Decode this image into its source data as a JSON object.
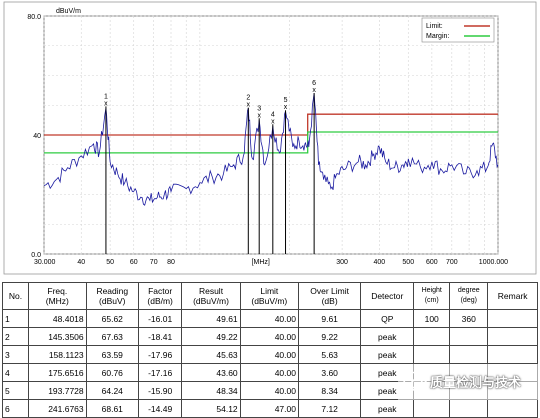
{
  "chart_data": {
    "type": "line",
    "unit_label": "dBuV/m",
    "x_unit_label": "[MHz]",
    "xscale": "log",
    "xlim": [
      30,
      1000
    ],
    "ylim": [
      0,
      80
    ],
    "x_tick_labels": [
      "30.000",
      "40",
      "50",
      "60",
      "70",
      "80",
      "300",
      "400",
      "500",
      "600",
      "700",
      "1000.000"
    ],
    "x_tick_values": [
      30,
      40,
      50,
      60,
      70,
      80,
      300,
      400,
      500,
      600,
      700,
      1000
    ],
    "y_tick_labels": [
      "80.0",
      "40",
      "0.0"
    ],
    "y_tick_values": [
      80,
      40,
      0
    ],
    "grid": true,
    "legend_position": "top-right",
    "legend": [
      {
        "name": "Limit:",
        "color": "#c0392b"
      },
      {
        "name": "Margin:",
        "color": "#2ecc40"
      }
    ],
    "limit_line": {
      "color": "#c0392b",
      "points": [
        [
          30,
          40
        ],
        [
          230,
          40
        ],
        [
          230,
          47
        ],
        [
          1000,
          47
        ]
      ]
    },
    "margin_line": {
      "color": "#2ecc40",
      "points": [
        [
          30,
          34
        ],
        [
          230,
          34
        ],
        [
          230,
          41
        ],
        [
          1000,
          41
        ]
      ]
    },
    "trace": {
      "color": "#1a1aa0",
      "x": [
        30,
        33,
        36,
        40,
        44,
        46,
        48.4,
        50,
        53,
        56,
        60,
        64,
        68,
        72,
        76,
        80,
        90,
        100,
        110,
        120,
        130,
        140,
        145.35,
        150,
        158.11,
        165,
        175.65,
        185,
        193.77,
        205,
        215,
        225,
        232,
        241.68,
        250,
        260,
        275,
        290,
        310,
        340,
        360,
        380,
        400,
        420,
        450,
        480,
        500,
        550,
        600,
        650,
        700,
        780,
        850,
        920,
        960,
        1000
      ],
      "y": [
        23,
        25,
        29,
        33,
        37,
        34,
        49,
        31,
        27,
        24,
        21,
        19,
        18,
        19,
        20,
        21,
        22,
        24,
        26,
        27,
        30,
        33,
        49,
        32,
        45,
        30,
        43,
        34,
        48,
        36,
        38,
        37,
        36,
        54,
        30,
        25,
        22,
        27,
        29,
        31,
        30,
        33,
        36,
        31,
        29,
        30,
        32,
        29,
        31,
        28,
        30,
        27,
        28,
        29,
        37,
        30
      ]
    },
    "markers": [
      {
        "label": "1",
        "freq": 48.4018,
        "level": 49.61
      },
      {
        "label": "2",
        "freq": 145.3506,
        "level": 49.22
      },
      {
        "label": "3",
        "freq": 158.1123,
        "level": 45.63
      },
      {
        "label": "4",
        "freq": 175.6516,
        "level": 43.6
      },
      {
        "label": "5",
        "freq": 193.7728,
        "level": 48.34
      },
      {
        "label": "6",
        "freq": 241.6763,
        "level": 54.12
      }
    ]
  },
  "table": {
    "headers": [
      {
        "key": "no",
        "text": "No."
      },
      {
        "key": "freq",
        "text": "Freq.\n(MHz)"
      },
      {
        "key": "reading",
        "text": "Reading\n(dBuV)"
      },
      {
        "key": "factor",
        "text": "Factor\n(dB/m)"
      },
      {
        "key": "result",
        "text": "Result\n(dBuV/m)"
      },
      {
        "key": "limit",
        "text": "Limit\n(dBuV/m)"
      },
      {
        "key": "over",
        "text": "Over Limit\n(dB)"
      },
      {
        "key": "detector",
        "text": "Detector"
      },
      {
        "key": "height",
        "text": "Height\n(cm)"
      },
      {
        "key": "degree",
        "text": "degree\n(deg)"
      },
      {
        "key": "remark",
        "text": "Remark"
      }
    ],
    "rows": [
      {
        "no": "1",
        "freq": "48.4018",
        "reading": "65.62",
        "factor": "-16.01",
        "result": "49.61",
        "limit": "40.00",
        "over": "9.61",
        "detector": "QP",
        "height": "100",
        "degree": "360",
        "remark": ""
      },
      {
        "no": "2",
        "freq": "145.3506",
        "reading": "67.63",
        "factor": "-18.41",
        "result": "49.22",
        "limit": "40.00",
        "over": "9.22",
        "detector": "peak",
        "height": "",
        "degree": "",
        "remark": ""
      },
      {
        "no": "3",
        "freq": "158.1123",
        "reading": "63.59",
        "factor": "-17.96",
        "result": "45.63",
        "limit": "40.00",
        "over": "5.63",
        "detector": "peak",
        "height": "",
        "degree": "",
        "remark": ""
      },
      {
        "no": "4",
        "freq": "175.6516",
        "reading": "60.76",
        "factor": "-17.16",
        "result": "43.60",
        "limit": "40.00",
        "over": "3.60",
        "detector": "peak",
        "height": "",
        "degree": "",
        "remark": ""
      },
      {
        "no": "5",
        "freq": "193.7728",
        "reading": "64.24",
        "factor": "-15.90",
        "result": "48.34",
        "limit": "40.00",
        "over": "8.34",
        "detector": "peak",
        "height": "",
        "degree": "",
        "remark": ""
      },
      {
        "no": "6",
        "freq": "241.6763",
        "reading": "68.61",
        "factor": "-14.49",
        "result": "54.12",
        "limit": "47.00",
        "over": "7.12",
        "detector": "peak",
        "height": "",
        "degree": "",
        "remark": ""
      }
    ]
  },
  "watermark": {
    "text": "质量检测与技术",
    "icon": "wechat-logo-icon"
  }
}
